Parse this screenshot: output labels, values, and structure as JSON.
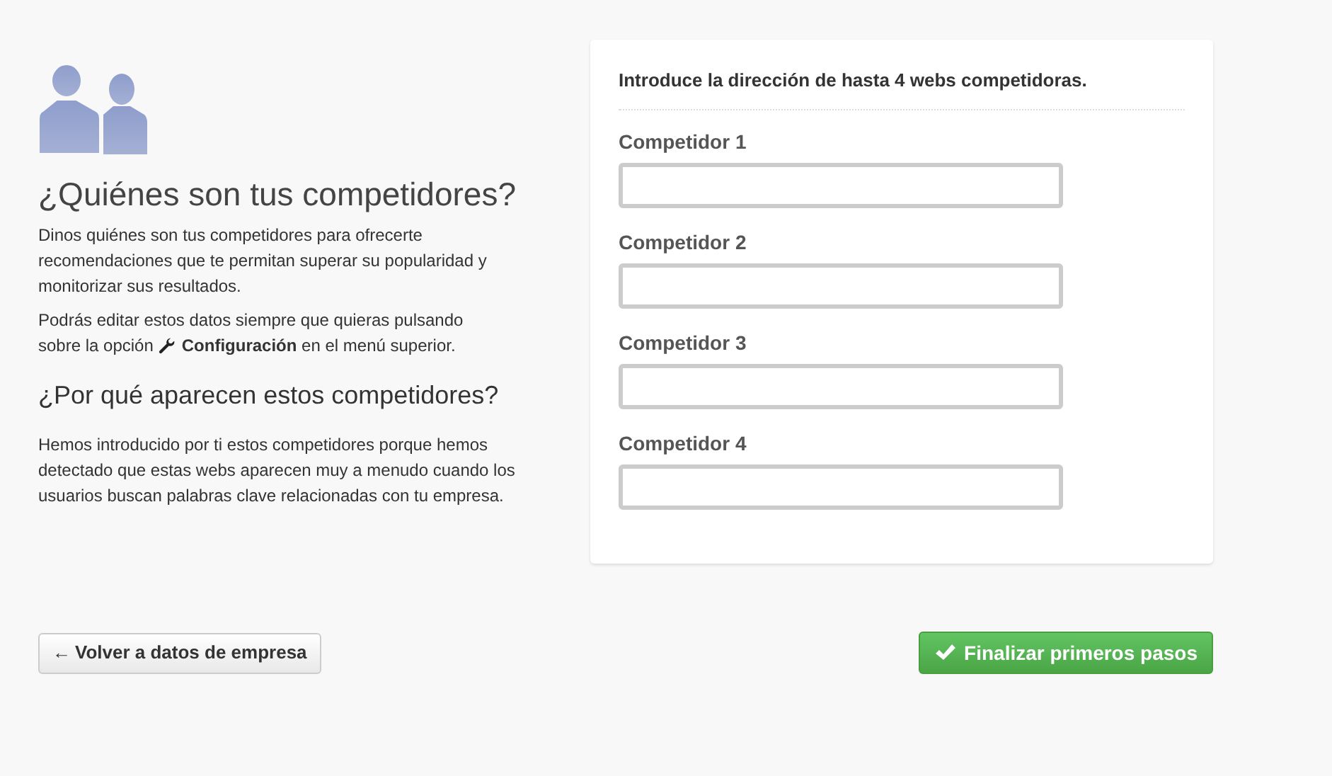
{
  "intro": {
    "title": "¿Quiénes son tus competidores?",
    "paragraph_1": "Dinos quiénes son tus competidores para ofrecerte recomendaciones que te permitan superar su popularidad y monitorizar sus resultados.",
    "paragraph_2_line_1": "Podrás editar estos datos siempre que quieras pulsando",
    "paragraph_2_before": "sobre la opción",
    "paragraph_2_after": "**Configuración** en el menú superior.",
    "subtitle": "¿Por qué aparecen estos competidores?",
    "paragraph_3": "Hemos introducido por ti estos competidores porque hemos detectado que estas webs aparecen muy a menudo cuando los usuarios buscan palabras clave relacionadas con tu empresa."
  },
  "form": {
    "heading": "Introduce la dirección de hasta 4 webs competidoras.",
    "fields": [
      {
        "label": "Competidor 1"
      },
      {
        "label": "Competidor 2"
      },
      {
        "label": "Competidor 3"
      },
      {
        "label": "Competidor 4"
      }
    ]
  },
  "buttons": {
    "back": {
      "arrow": "←",
      "label": "Volver a datos de empresa"
    },
    "finish": {
      "label": "Finalizar primeros pasos"
    }
  }
}
